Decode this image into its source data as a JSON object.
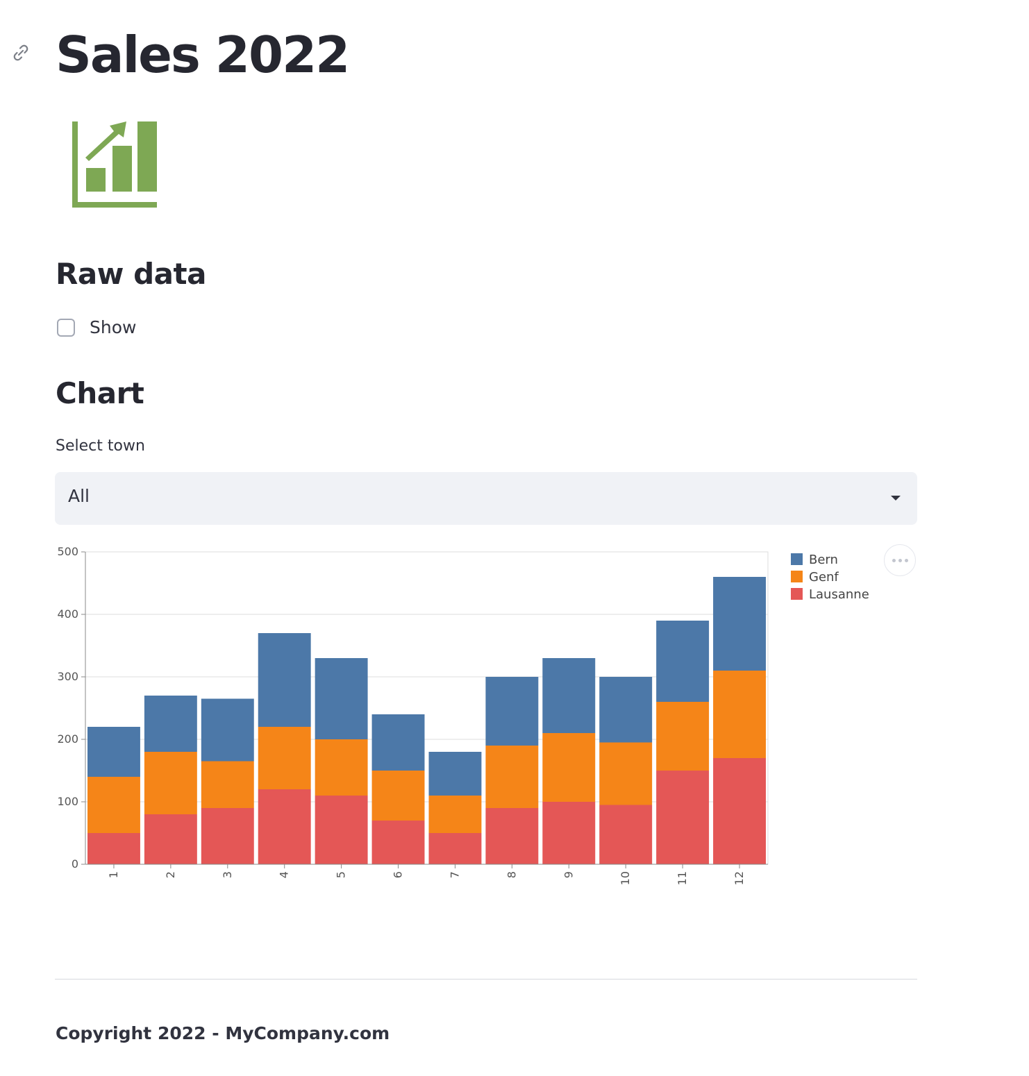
{
  "page": {
    "title": "Sales 2022",
    "logo_icon": "bar-chart-growth-icon",
    "logo_color": "#7ea854"
  },
  "raw_data": {
    "heading": "Raw data",
    "show_checkbox_label": "Show",
    "show_checked": false
  },
  "chart_section": {
    "heading": "Chart",
    "select_label": "Select town",
    "select_value": "All"
  },
  "chart_data": {
    "type": "bar",
    "stacked": true,
    "categories": [
      "1",
      "2",
      "3",
      "4",
      "5",
      "6",
      "7",
      "8",
      "9",
      "10",
      "11",
      "12"
    ],
    "series": [
      {
        "name": "Lausanne",
        "color": "#e45756",
        "values": [
          50,
          80,
          90,
          120,
          110,
          70,
          50,
          90,
          100,
          95,
          150,
          170
        ]
      },
      {
        "name": "Genf",
        "color": "#f58518",
        "values": [
          90,
          100,
          75,
          100,
          90,
          80,
          60,
          100,
          110,
          100,
          110,
          140
        ]
      },
      {
        "name": "Bern",
        "color": "#4c78a8",
        "values": [
          80,
          90,
          100,
          150,
          130,
          90,
          70,
          110,
          120,
          105,
          130,
          150
        ]
      }
    ],
    "legend_order": [
      "Bern",
      "Genf",
      "Lausanne"
    ],
    "ylim": [
      0,
      500
    ],
    "yticks": [
      0,
      100,
      200,
      300,
      400,
      500
    ],
    "grid": true,
    "legend_position": "right"
  },
  "footer": {
    "text": "Copyright 2022 - MyCompany.com"
  }
}
